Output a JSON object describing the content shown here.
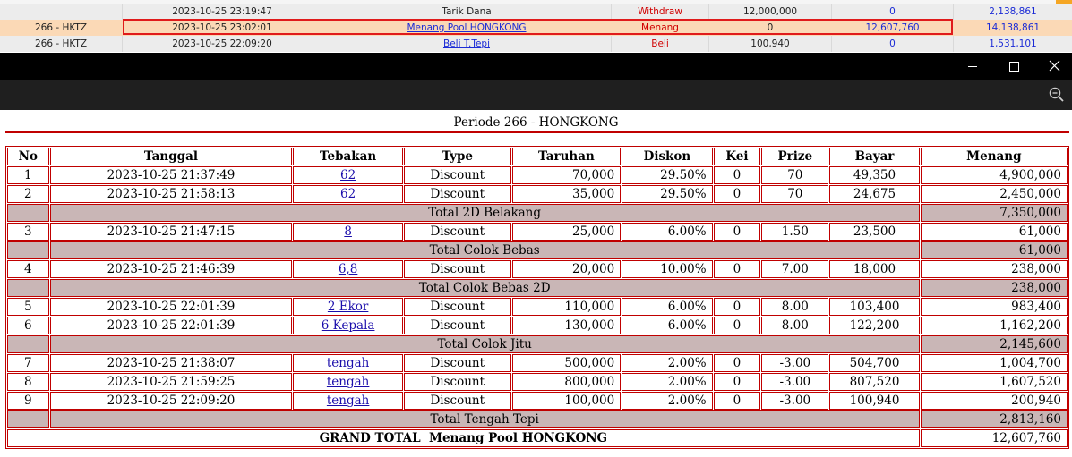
{
  "transactions": [
    {
      "code": "",
      "datetime": "2023-10-25 23:19:47",
      "description": "Tarik Dana",
      "type": "Withdraw",
      "debit": "12,000,000",
      "credit": "0",
      "balance": "2,138,861",
      "link": false
    },
    {
      "code": "266 - HKTZ",
      "datetime": "2023-10-25 23:02:01",
      "description": "Menang Pool HONGKONG",
      "type": "Menang",
      "debit": "0",
      "credit": "12,607,760",
      "balance": "14,138,861",
      "link": true
    },
    {
      "code": "266 - HKTZ",
      "datetime": "2023-10-25 22:09:20",
      "description": "Beli T.Tepi",
      "type": "Beli",
      "debit": "100,940",
      "credit": "0",
      "balance": "1,531,101",
      "link": true
    }
  ],
  "window": {
    "controls": [
      "minimize-icon",
      "maximize-icon",
      "close-icon"
    ],
    "toolbar_icon": "zoom-out-icon"
  },
  "period_title": "Periode 266 - HONGKONG",
  "headers": [
    "No",
    "Tanggal",
    "Tebakan",
    "Type",
    "Taruhan",
    "Diskon",
    "Kei",
    "Prize",
    "Bayar",
    "Menang"
  ],
  "rows": [
    {
      "kind": "item",
      "no": "1",
      "tanggal": "2023-10-25 21:37:49",
      "tebakan": "62",
      "type": "Discount",
      "taruhan": "70,000",
      "diskon": "29.50%",
      "kei": "0",
      "prize": "70",
      "bayar": "49,350",
      "menang": "4,900,000"
    },
    {
      "kind": "item",
      "no": "2",
      "tanggal": "2023-10-25 21:58:13",
      "tebakan": "62",
      "type": "Discount",
      "taruhan": "35,000",
      "diskon": "29.50%",
      "kei": "0",
      "prize": "70",
      "bayar": "24,675",
      "menang": "2,450,000"
    },
    {
      "kind": "subtotal",
      "label": "Total 2D Belakang",
      "menang": "7,350,000"
    },
    {
      "kind": "item",
      "no": "3",
      "tanggal": "2023-10-25 21:47:15",
      "tebakan": "8",
      "type": "Discount",
      "taruhan": "25,000",
      "diskon": "6.00%",
      "kei": "0",
      "prize": "1.50",
      "bayar": "23,500",
      "menang": "61,000"
    },
    {
      "kind": "subtotal",
      "label": "Total Colok Bebas",
      "menang": "61,000"
    },
    {
      "kind": "item",
      "no": "4",
      "tanggal": "2023-10-25 21:46:39",
      "tebakan": "6,8",
      "type": "Discount",
      "taruhan": "20,000",
      "diskon": "10.00%",
      "kei": "0",
      "prize": "7.00",
      "bayar": "18,000",
      "menang": "238,000"
    },
    {
      "kind": "subtotal",
      "label": "Total Colok Bebas 2D",
      "menang": "238,000"
    },
    {
      "kind": "item",
      "no": "5",
      "tanggal": "2023-10-25 22:01:39",
      "tebakan": "2 Ekor",
      "type": "Discount",
      "taruhan": "110,000",
      "diskon": "6.00%",
      "kei": "0",
      "prize": "8.00",
      "bayar": "103,400",
      "menang": "983,400"
    },
    {
      "kind": "item",
      "no": "6",
      "tanggal": "2023-10-25 22:01:39",
      "tebakan": "6 Kepala",
      "type": "Discount",
      "taruhan": "130,000",
      "diskon": "6.00%",
      "kei": "0",
      "prize": "8.00",
      "bayar": "122,200",
      "menang": "1,162,200"
    },
    {
      "kind": "subtotal",
      "label": "Total Colok Jitu",
      "menang": "2,145,600"
    },
    {
      "kind": "item",
      "no": "7",
      "tanggal": "2023-10-25 21:38:07",
      "tebakan": "tengah",
      "type": "Discount",
      "taruhan": "500,000",
      "diskon": "2.00%",
      "kei": "0",
      "prize": "-3.00",
      "bayar": "504,700",
      "menang": "1,004,700"
    },
    {
      "kind": "item",
      "no": "8",
      "tanggal": "2023-10-25 21:59:25",
      "tebakan": "tengah",
      "type": "Discount",
      "taruhan": "800,000",
      "diskon": "2.00%",
      "kei": "0",
      "prize": "-3.00",
      "bayar": "807,520",
      "menang": "1,607,520"
    },
    {
      "kind": "item",
      "no": "9",
      "tanggal": "2023-10-25 22:09:20",
      "tebakan": "tengah",
      "type": "Discount",
      "taruhan": "100,000",
      "diskon": "2.00%",
      "kei": "0",
      "prize": "-3.00",
      "bayar": "100,940",
      "menang": "200,940"
    },
    {
      "kind": "subtotal",
      "label": "Total Tengah Tepi",
      "menang": "2,813,160"
    }
  ],
  "grand_total": {
    "label": "GRAND TOTAL  Menang Pool HONGKONG",
    "value": "12,607,760"
  }
}
